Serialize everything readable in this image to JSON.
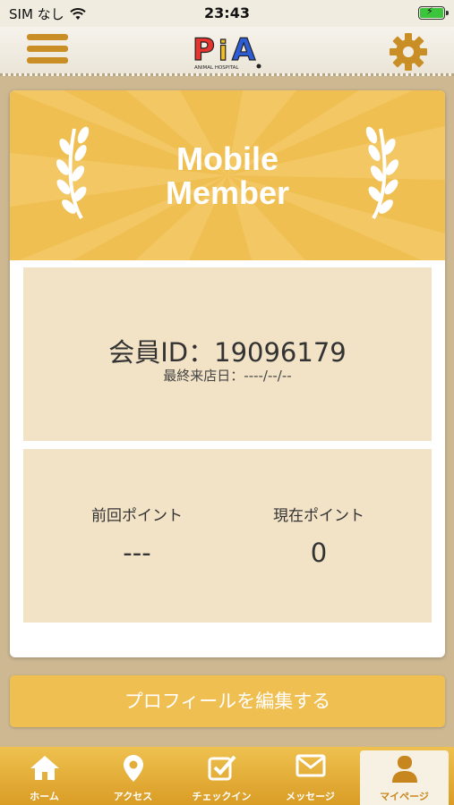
{
  "status_bar": {
    "carrier": "SIM なし",
    "time": "23:43"
  },
  "header": {
    "logo_text": "PiA",
    "logo_sub": "ANIMAL HOSPITAL"
  },
  "card": {
    "banner_title_line1": "Mobile",
    "banner_title_line2": "Member",
    "member_id": "会員ID：19096179",
    "last_visit": "最終来店日：----/--/--",
    "points": {
      "previous_label": "前回ポイント",
      "previous_value": "---",
      "current_label": "現在ポイント",
      "current_value": "0"
    }
  },
  "edit_profile_label": "プロフィールを編集する",
  "tabs": [
    {
      "label": "ホーム",
      "icon": "home-icon"
    },
    {
      "label": "アクセス",
      "icon": "map-pin-icon"
    },
    {
      "label": "チェックイン",
      "icon": "checkbox-icon"
    },
    {
      "label": "メッセージ",
      "icon": "envelope-icon"
    },
    {
      "label": "マイページ",
      "icon": "user-icon"
    }
  ],
  "colors": {
    "accent": "#f0bf52",
    "panel": "#f2e2c6",
    "active_tab_text": "#c8871e"
  }
}
